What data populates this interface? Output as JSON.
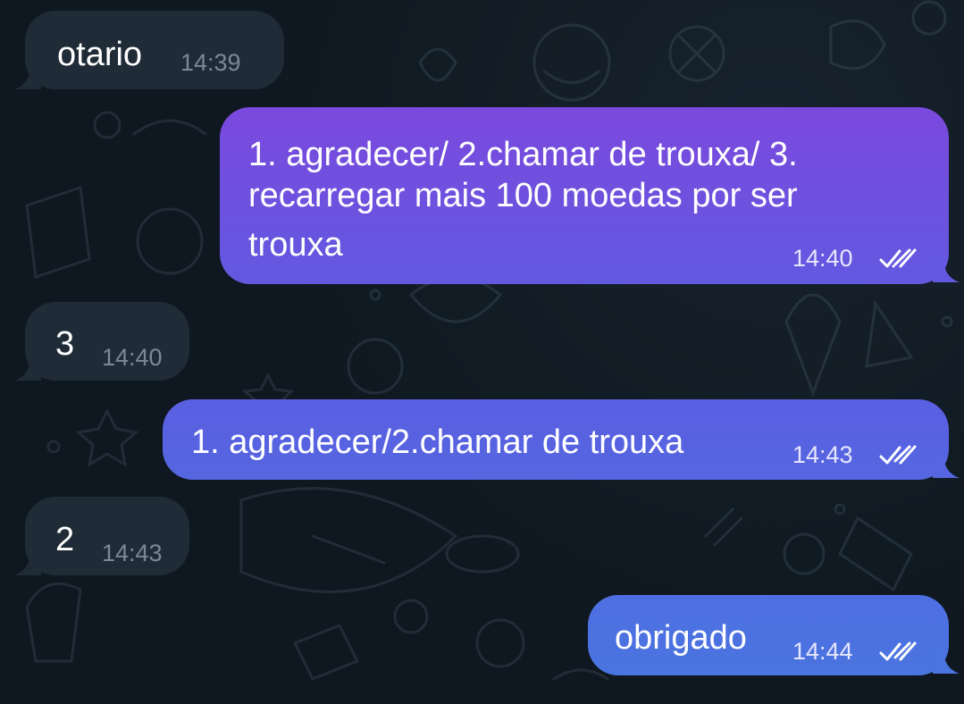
{
  "messages": [
    {
      "direction": "incoming",
      "text": "otario",
      "time": "14:39"
    },
    {
      "direction": "outgoing",
      "lines": [
        "1. agradecer/ 2.chamar de trouxa/ 3.",
        "recarregar mais 100 moedas por ser",
        "trouxa"
      ],
      "time": "14:40",
      "status_icon": "double-check-read-icon"
    },
    {
      "direction": "incoming",
      "text": "3",
      "time": "14:40"
    },
    {
      "direction": "outgoing",
      "text": "1. agradecer/2.chamar de trouxa",
      "time": "14:43",
      "status_icon": "double-check-read-icon"
    },
    {
      "direction": "incoming",
      "text": "2",
      "time": "14:43"
    },
    {
      "direction": "outgoing",
      "text": "obrigado",
      "time": "14:44",
      "status_icon": "double-check-read-icon"
    }
  ],
  "colors": {
    "background": "#0f1820",
    "incoming_bubble": "#1f2b36",
    "outgoing_top": "#7b49dd",
    "outgoing_bottom": "#4a6fe0"
  }
}
